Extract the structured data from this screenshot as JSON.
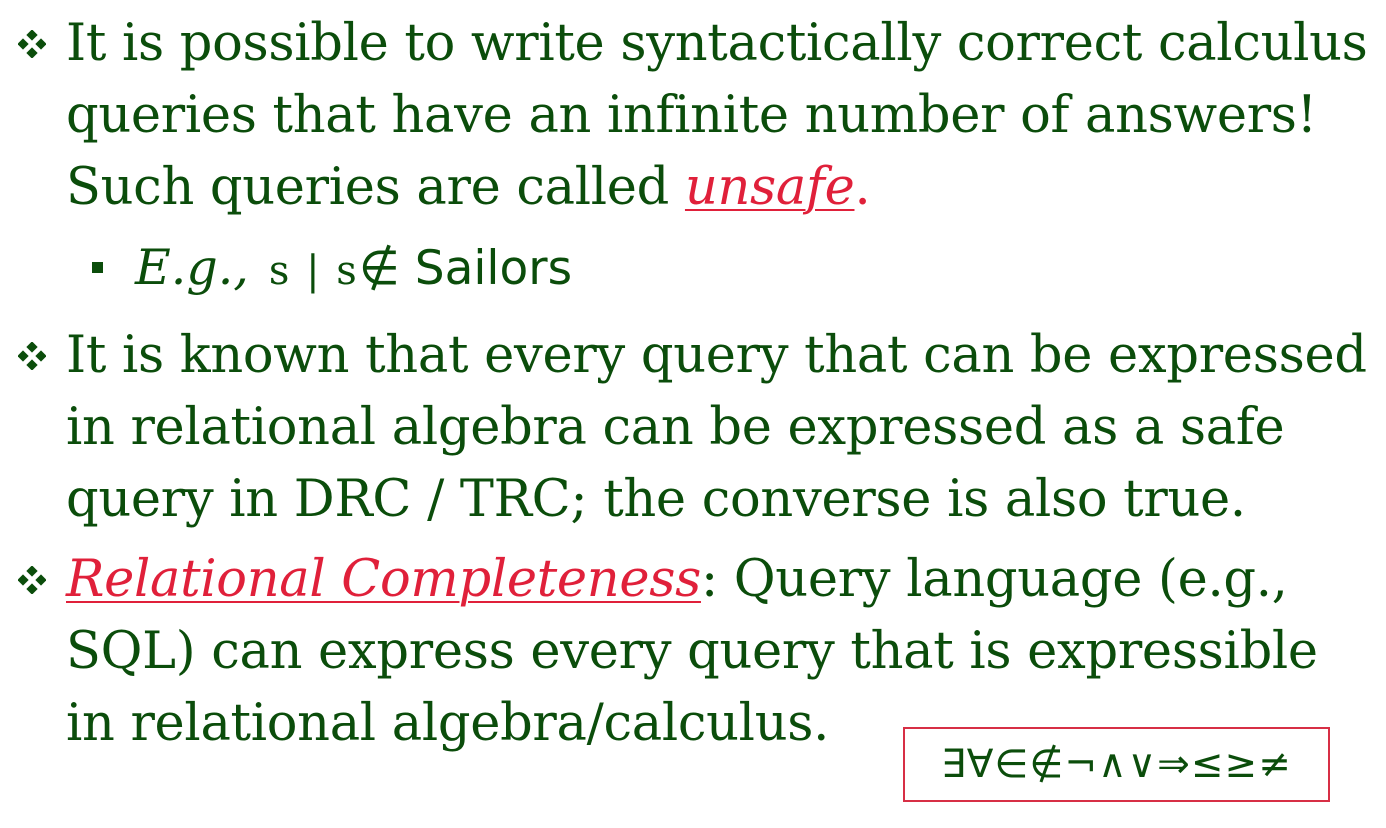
{
  "bullets": [
    {
      "line1": "It is possible to write syntactically correct calculus",
      "line2": "queries that have an infinite number of answers!",
      "line3_before": "Such queries are called ",
      "line3_term": "unsafe",
      "line3_after": "."
    },
    {
      "line1": "It is known that every query that can be expressed",
      "line2": "in relational algebra can be expressed as a safe",
      "line3": "query in DRC / TRC; the converse is also true."
    },
    {
      "term": "Relational Completeness",
      "line1_after": ":  Query language (e.g.,",
      "line2": "SQL) can express every query that is expressible",
      "line3": "in relational algebra/calculus."
    }
  ],
  "example": {
    "prefix": "E.g.,",
    "query": "s | s",
    "symbol": "∉",
    "relation": " Sailors"
  },
  "symbols_box": "∃∀∈∉¬∧∨⇒≤≥≠",
  "colors": {
    "text": "#0b4d0b",
    "term": "#e0203a",
    "box_border": "#d72f45"
  },
  "icons": {
    "bullet": "diamond-bullet-icon",
    "sub_bullet": "square-bullet-icon"
  }
}
